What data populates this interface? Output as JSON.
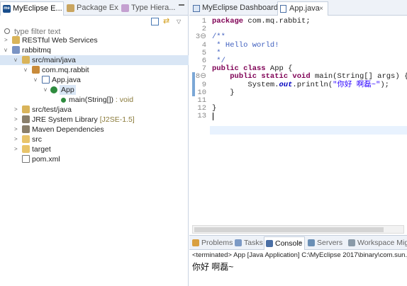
{
  "left_panel": {
    "tabs": [
      {
        "label": "MyEclipse E..."
      },
      {
        "label": "Package Ex..."
      },
      {
        "label": "Type Hiera..."
      }
    ],
    "filter_placeholder": "type filter text",
    "tree": [
      {
        "label": "RESTful Web Services",
        "decoration": ""
      },
      {
        "label": "rabbitmq",
        "decoration": ""
      },
      {
        "label": "src/main/java",
        "decoration": ""
      },
      {
        "label": "com.mq.rabbit",
        "decoration": ""
      },
      {
        "label": "App.java",
        "decoration": ""
      },
      {
        "label": "App",
        "decoration": ""
      },
      {
        "label": "main(String[])",
        "decoration": " : void"
      },
      {
        "label": "src/test/java",
        "decoration": ""
      },
      {
        "label": "JRE System Library",
        "decoration": " [J2SE-1.5]"
      },
      {
        "label": "Maven Dependencies",
        "decoration": ""
      },
      {
        "label": "src",
        "decoration": ""
      },
      {
        "label": "target",
        "decoration": ""
      },
      {
        "label": "pom.xml",
        "decoration": ""
      }
    ]
  },
  "editor": {
    "tabs": [
      {
        "label": "MyEclipse Dashboard"
      },
      {
        "label": "App.java"
      }
    ],
    "line_numbers": [
      "1",
      "2",
      "3⊖",
      "4",
      "5",
      "6",
      "7",
      "8⊖",
      "9",
      "10",
      "11",
      "12",
      "13"
    ],
    "lines": [
      {
        "parts": [
          {
            "t": "package",
            "c": "kw"
          },
          {
            "t": " com.mq.rabbit;",
            "c": ""
          }
        ]
      },
      {
        "parts": []
      },
      {
        "parts": [
          {
            "t": "/**",
            "c": "cm"
          }
        ]
      },
      {
        "parts": [
          {
            "t": " * Hello world!",
            "c": "cm"
          }
        ]
      },
      {
        "parts": [
          {
            "t": " *",
            "c": "cm"
          }
        ]
      },
      {
        "parts": [
          {
            "t": " */",
            "c": "cm"
          }
        ]
      },
      {
        "parts": [
          {
            "t": "public class",
            "c": "kw"
          },
          {
            "t": " App {",
            "c": ""
          }
        ]
      },
      {
        "parts": [
          {
            "t": "    ",
            "c": ""
          },
          {
            "t": "public static void",
            "c": "kw"
          },
          {
            "t": " main(String[] args) {",
            "c": ""
          }
        ]
      },
      {
        "parts": [
          {
            "t": "        System.",
            "c": ""
          },
          {
            "t": "out",
            "c": "fld"
          },
          {
            "t": ".println(",
            "c": ""
          },
          {
            "t": "\"你好 啊磊~\"",
            "c": "st"
          },
          {
            "t": ");",
            "c": ""
          }
        ]
      },
      {
        "parts": [
          {
            "t": "    }",
            "c": ""
          }
        ]
      },
      {
        "parts": []
      },
      {
        "parts": [
          {
            "t": "}",
            "c": ""
          }
        ]
      },
      {
        "parts": []
      }
    ]
  },
  "console": {
    "tabs": [
      {
        "label": "Problems"
      },
      {
        "label": "Tasks"
      },
      {
        "label": "Console"
      },
      {
        "label": "Servers"
      },
      {
        "label": "Workspace Migr"
      }
    ],
    "terminated": "<terminated> App [Java Application] C:\\MyEclipse 2017\\binary\\com.sun.jav",
    "output": "你好 啊磊~"
  },
  "colors": {
    "keyword": "#7f0055",
    "comment": "#3f5fbf",
    "string": "#2a00ff",
    "field": "#0000c0",
    "selection": "#d9e6f5",
    "tab_bar": "#eef2f8"
  }
}
